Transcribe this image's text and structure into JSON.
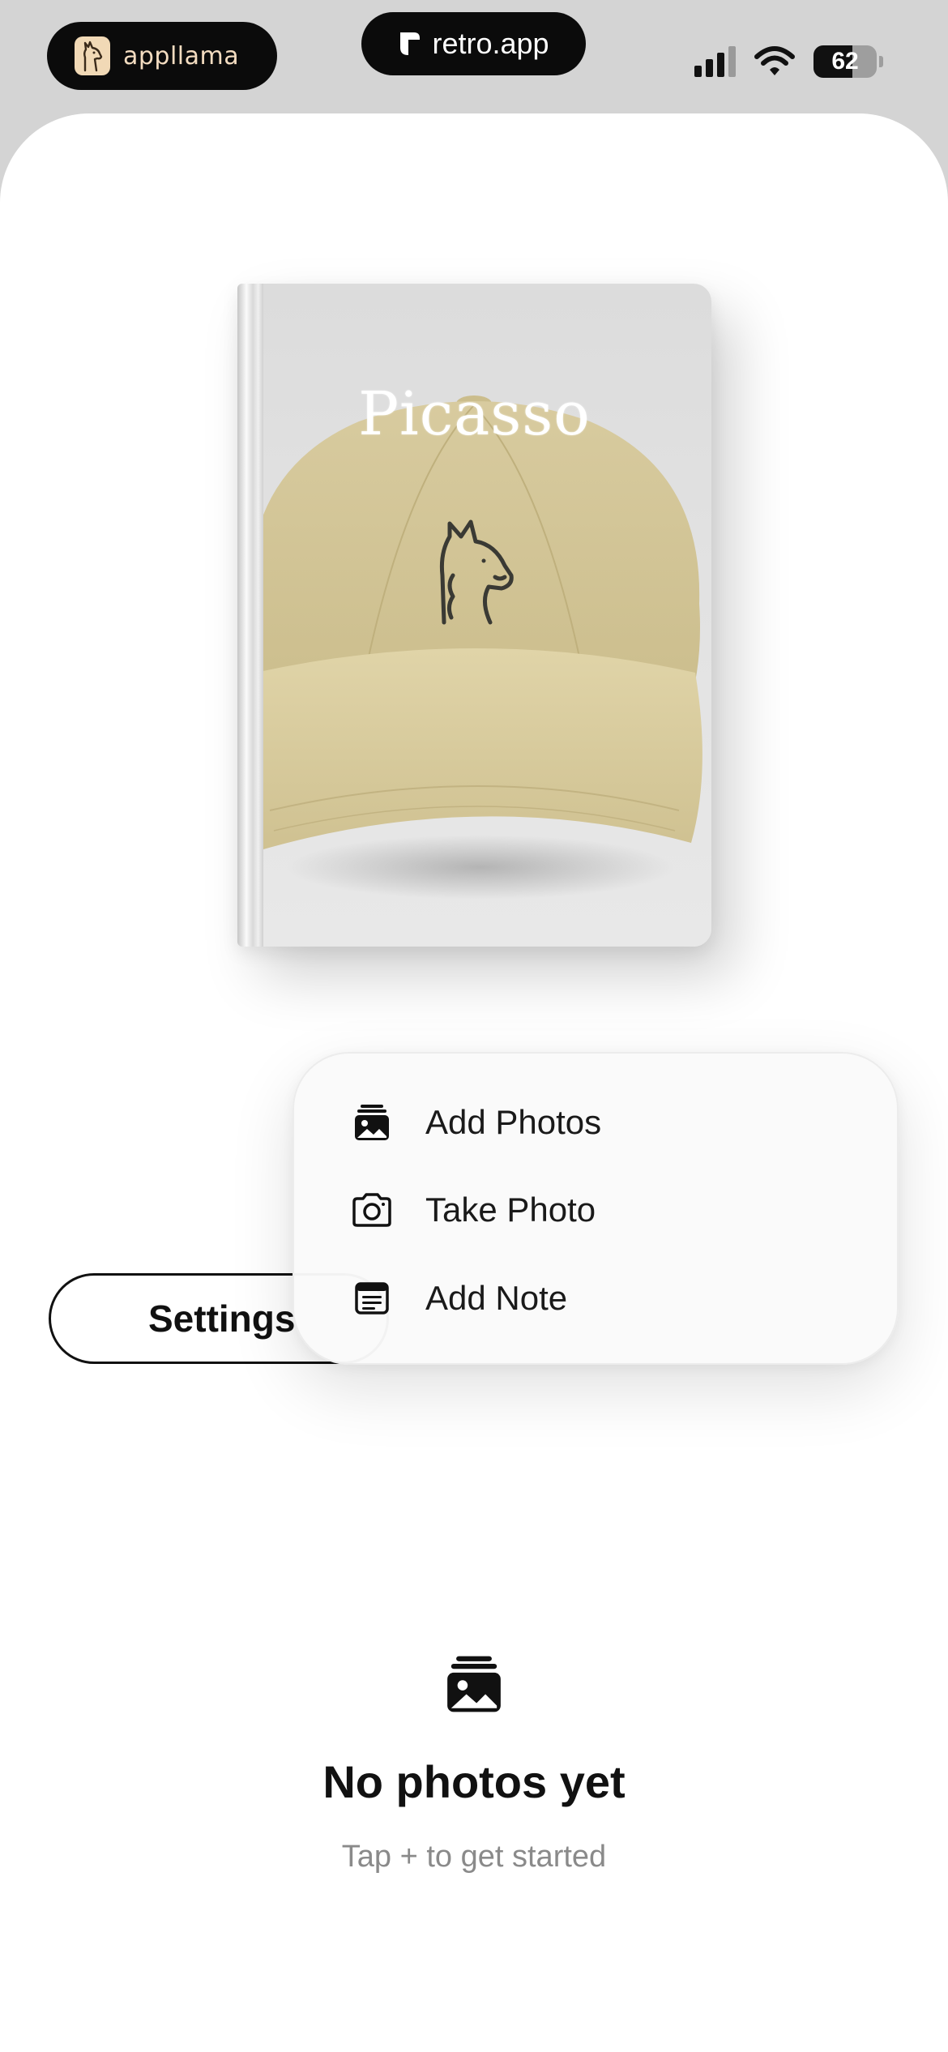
{
  "status_bar": {
    "left_pill_label": "appllama",
    "center_pill_label": "retro.app",
    "battery_level": "62",
    "battery_fraction": 0.62,
    "signal_bars_active": 3,
    "signal_bars_total": 4,
    "icons": [
      "llama-logo-icon",
      "retro-logo-icon",
      "signal-icon",
      "wifi-icon",
      "battery-icon"
    ]
  },
  "album": {
    "title": "Picasso",
    "cover_image": "khaki-baseball-cap-with-llama-logo",
    "cap_color": "#d6c89c"
  },
  "settings_button": {
    "label": "Settings"
  },
  "add_menu": {
    "items": [
      {
        "label": "Add Photos",
        "icon": "photo-stack-icon"
      },
      {
        "label": "Take Photo",
        "icon": "camera-icon"
      },
      {
        "label": "Add Note",
        "icon": "note-icon"
      }
    ]
  },
  "empty_state": {
    "icon": "photo-stack-icon",
    "title": "No photos yet",
    "subtitle": "Tap + to get started"
  }
}
